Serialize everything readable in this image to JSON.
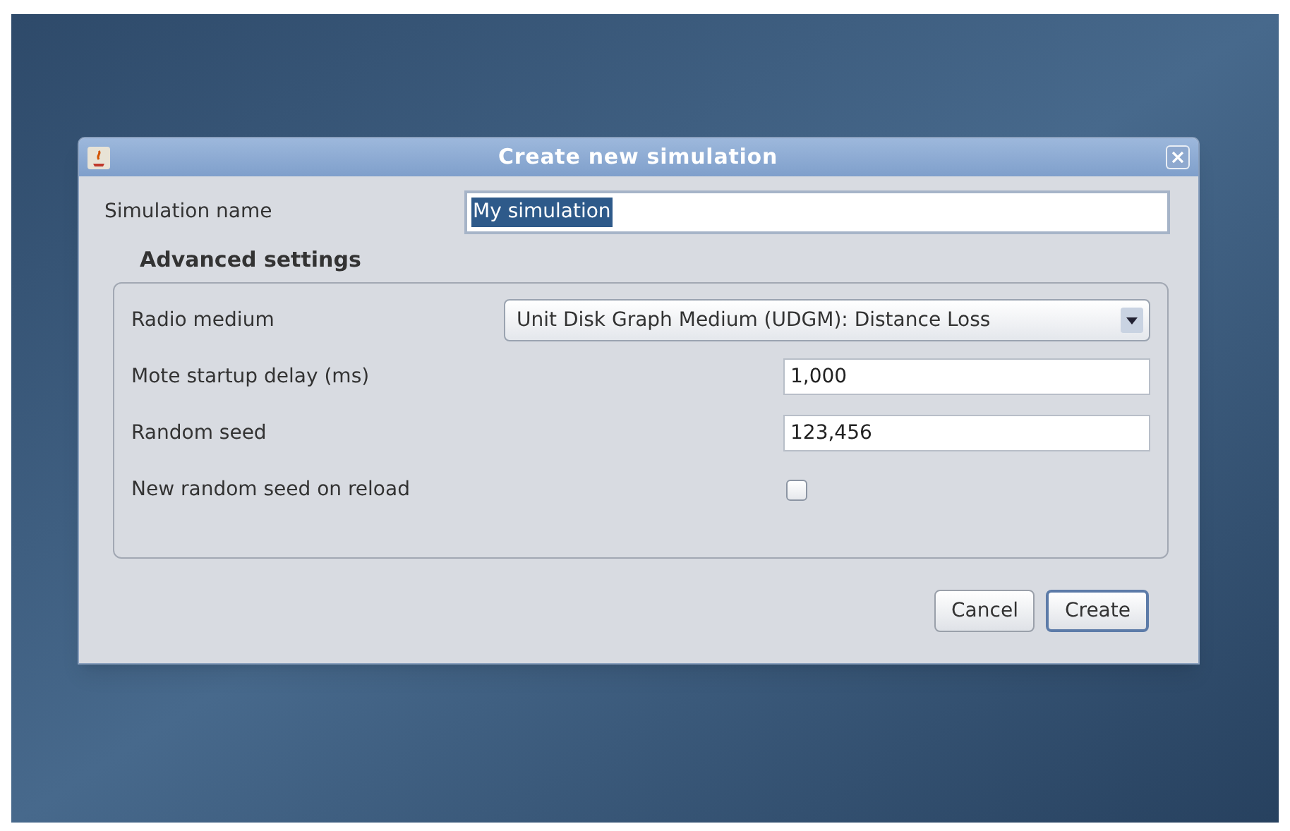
{
  "window": {
    "title": "Create new simulation"
  },
  "name_field": {
    "label": "Simulation name",
    "value": "My simulation",
    "text_selected": true
  },
  "advanced": {
    "title": "Advanced settings",
    "rows": [
      {
        "kind": "dropdown",
        "label": "Radio medium",
        "value": "Unit Disk Graph Medium (UDGM): Distance Loss"
      },
      {
        "kind": "text",
        "label": "Mote startup delay (ms)",
        "value": "1,000"
      },
      {
        "kind": "text",
        "label": "Random seed",
        "value": "123,456"
      },
      {
        "kind": "checkbox",
        "label": "New random seed on reload",
        "checked": false
      }
    ]
  },
  "buttons": [
    {
      "label": "Cancel",
      "focused": false
    },
    {
      "label": "Create",
      "focused": true
    }
  ]
}
